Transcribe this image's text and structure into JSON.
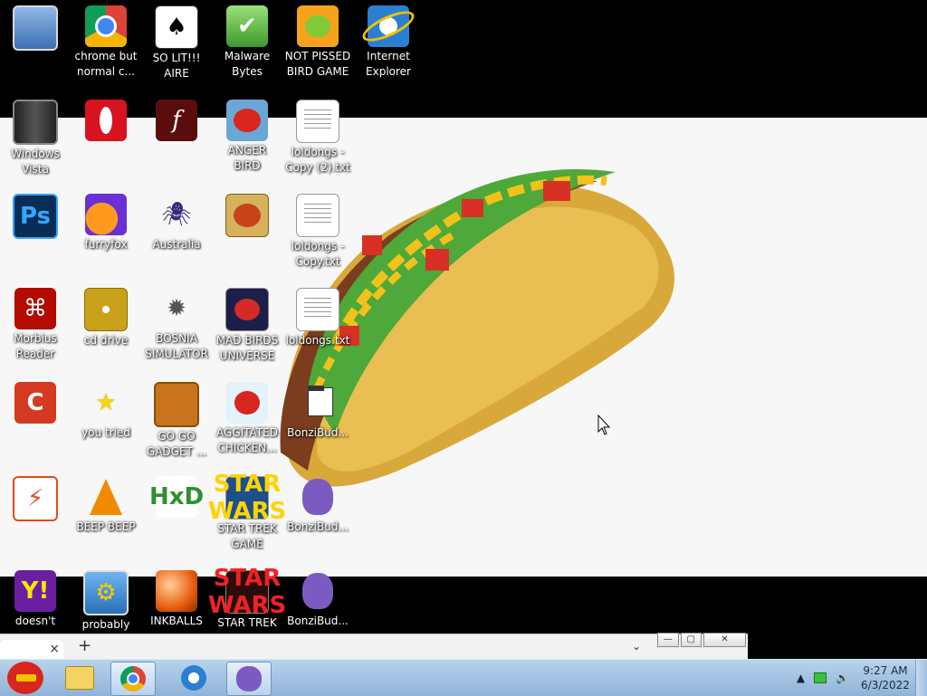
{
  "desktop": {
    "icons": [
      {
        "label": "",
        "glyph": "monitor-icon"
      },
      {
        "label": "chrome but normal c...",
        "glyph": "chrome-icon"
      },
      {
        "label": "SO LIT!!! AIRE",
        "glyph": "cards-icon"
      },
      {
        "label": "Malware Bytes",
        "glyph": "shield-icon"
      },
      {
        "label": "NOT PISSED BIRD GAME",
        "glyph": "pig-icon"
      },
      {
        "label": "Internet Explorer",
        "glyph": "ie-icon"
      },
      {
        "label": "Windows Vista",
        "glyph": "recycle-bin-icon"
      },
      {
        "label": "",
        "glyph": "opera-icon"
      },
      {
        "label": "",
        "glyph": "flash-icon"
      },
      {
        "label": "ANGER BIRD",
        "glyph": "angry-bird-icon"
      },
      {
        "label": "loldongs - Copy (2).txt",
        "glyph": "text-file-icon"
      },
      {
        "label": "",
        "glyph": "photoshop-icon"
      },
      {
        "label": "furryfox",
        "glyph": "firefox-icon"
      },
      {
        "label": "Australia",
        "glyph": "spider-icon"
      },
      {
        "label": "",
        "glyph": "seasons-bird-icon"
      },
      {
        "label": "loldongs - Copy.txt",
        "glyph": "text-file-icon"
      },
      {
        "label": "Morbius Reader",
        "glyph": "acrobat-icon"
      },
      {
        "label": "cd drive",
        "glyph": "cd-icon"
      },
      {
        "label": "BOSNIA SIMULATOR",
        "glyph": "mine-icon"
      },
      {
        "label": "MAD BIRDS UNIVERSE",
        "glyph": "space-bird-icon"
      },
      {
        "label": "loldongs.txt",
        "glyph": "text-file-icon"
      },
      {
        "label": "",
        "glyph": "ccleaner-icon"
      },
      {
        "label": "you tried",
        "glyph": "star-icon"
      },
      {
        "label": "GO GO GADGET ...",
        "glyph": "briefcase-icon"
      },
      {
        "label": "AGGITATED CHICKEN...",
        "glyph": "rio-bird-icon"
      },
      {
        "label": "BonziBud...",
        "glyph": "shortcut-file-icon"
      },
      {
        "label": "",
        "glyph": "lightning-icon"
      },
      {
        "label": "BEEP BEEP",
        "glyph": "vlc-icon"
      },
      {
        "label": "",
        "glyph": "hxd-icon"
      },
      {
        "label": "STAR TREK GAME",
        "glyph": "star-wars-bird-icon"
      },
      {
        "label": "BonziBud...",
        "glyph": "bonzi-icon"
      },
      {
        "label": "doesn't",
        "glyph": "yahoo-icon"
      },
      {
        "label": "probably",
        "glyph": "gears-icon"
      },
      {
        "label": "INKBALLS",
        "glyph": "inkball-icon"
      },
      {
        "label": "STAR TREK",
        "glyph": "star-wars-icon"
      },
      {
        "label": "BonziBud...",
        "glyph": "bonzi-icon"
      }
    ]
  },
  "browser_strip": {
    "tab_close": "×",
    "new_tab": "+",
    "tab_search": "⌄",
    "minimize": "—",
    "maximize": "▢",
    "close": "✕"
  },
  "taskbar": {
    "clock_time": "9:27 AM",
    "clock_date": "6/3/2022",
    "tray_arrow": "▲",
    "volume": "🔊"
  },
  "colors": {
    "desktop_bg": "#000000",
    "wallpaper": "#f7f7f7",
    "taskbar": "#a6c4e4"
  }
}
